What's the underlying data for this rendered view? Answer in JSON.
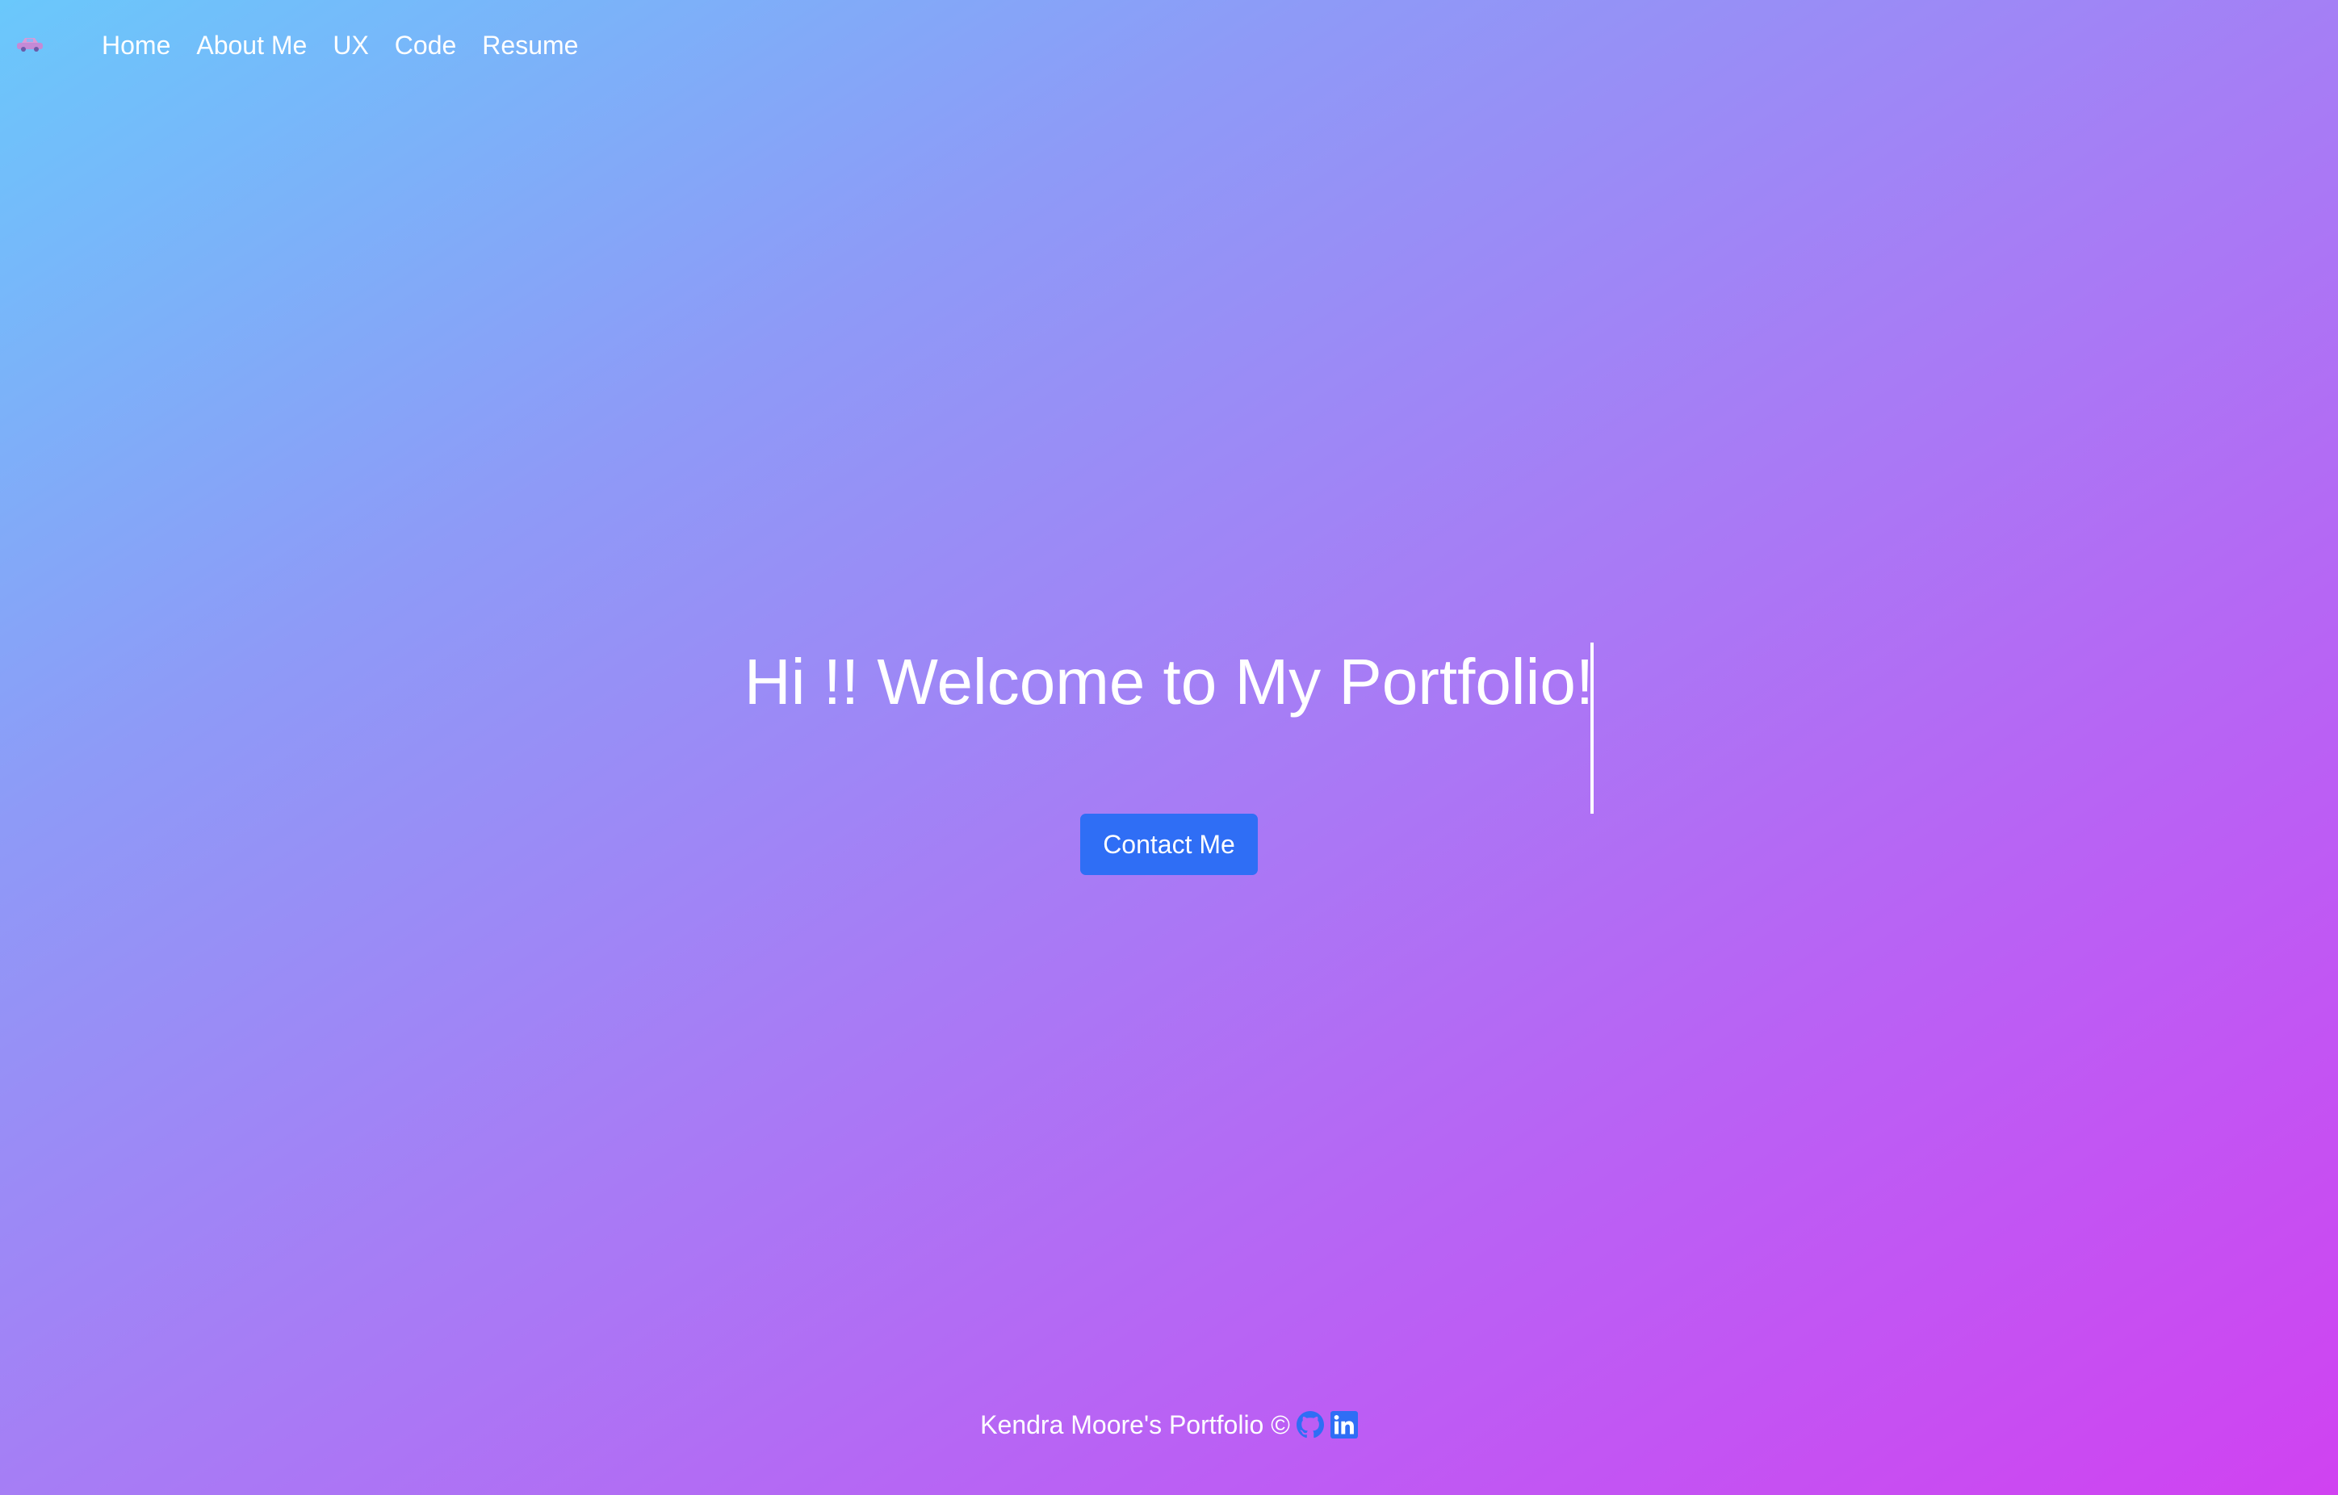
{
  "colors": {
    "background_gradient_start": "#6ac8fb",
    "background_gradient_end": "#d042f1",
    "accent_button": "#2f6ef5",
    "text": "#ffffff",
    "icon_blue": "#2f6ef5"
  },
  "navbar": {
    "logo_icon": "car-logo-icon",
    "items": [
      {
        "label": "Home"
      },
      {
        "label": "About Me"
      },
      {
        "label": "UX"
      },
      {
        "label": "Code"
      },
      {
        "label": "Resume"
      }
    ]
  },
  "hero": {
    "title": "Hi !! Welcome to My Portfolio!",
    "contact_button_label": "Contact Me"
  },
  "footer": {
    "text": "Kendra Moore's Portfolio ©",
    "icons": [
      "github-icon",
      "linkedin-icon"
    ]
  }
}
